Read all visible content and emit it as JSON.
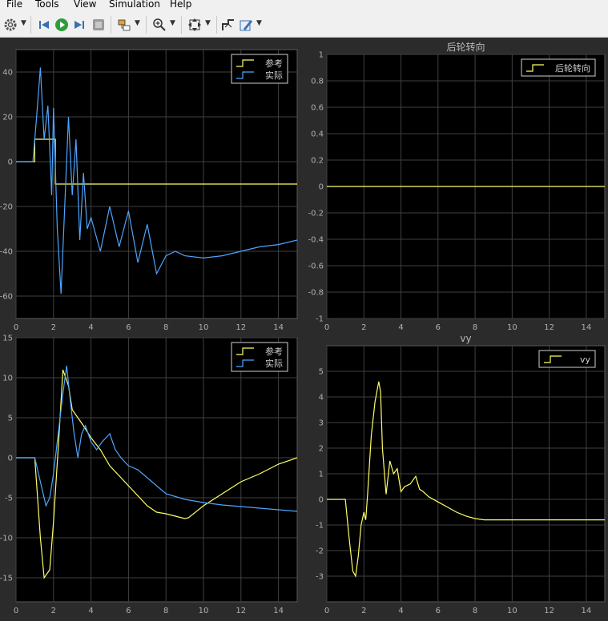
{
  "menubar": {
    "items": [
      "File",
      "Tools",
      "View",
      "Simulation",
      "Help"
    ]
  },
  "toolbar": {
    "icons": [
      "gear-icon",
      "step-back-icon",
      "run-icon",
      "step-forward-icon",
      "stop-icon",
      "highlight-block-icon",
      "zoom-icon",
      "fit-to-view-icon",
      "cursor-measure-icon",
      "edit-style-icon"
    ]
  },
  "colors": {
    "reference": "#ffff66",
    "actual": "#4da6ff",
    "axes_bg": "#000000",
    "figure_bg": "#2b2b2b",
    "grid": "#404040",
    "tick_text": "#b0b0b0"
  },
  "chart_data": [
    {
      "type": "line",
      "title": "",
      "xlim": [
        0,
        15
      ],
      "ylim": [
        -70,
        50
      ],
      "xticks": [
        0,
        2,
        4,
        6,
        8,
        10,
        12,
        14
      ],
      "yticks": [
        40,
        20,
        0,
        -20,
        -40,
        -60
      ],
      "grid": true,
      "legend_position": "top-right",
      "series": [
        {
          "name": "参考",
          "color": "#ffff66",
          "x": [
            0,
            1.0,
            1.0,
            2.1,
            2.1,
            15
          ],
          "y": [
            0,
            0,
            10,
            10,
            -10,
            -10
          ]
        },
        {
          "name": "实际",
          "color": "#4da6ff",
          "x": [
            0,
            0.9,
            1.1,
            1.3,
            1.5,
            1.7,
            1.9,
            2.0,
            2.2,
            2.4,
            2.6,
            2.8,
            3.0,
            3.2,
            3.4,
            3.6,
            3.8,
            4.0,
            4.5,
            5.0,
            5.5,
            6.0,
            6.5,
            7.0,
            7.5,
            8.0,
            8.5,
            9.0,
            10.0,
            11.0,
            12.0,
            13.0,
            14.0,
            15.0
          ],
          "y": [
            0,
            0,
            20,
            42,
            10,
            25,
            -15,
            24,
            -30,
            -59,
            -20,
            20,
            -15,
            10,
            -35,
            -5,
            -30,
            -25,
            -40,
            -20,
            -38,
            -22,
            -45,
            -28,
            -50,
            -42,
            -40,
            -42,
            -43,
            -42,
            -40,
            -38,
            -37,
            -35
          ]
        }
      ]
    },
    {
      "type": "line",
      "title": "后轮转向",
      "xlim": [
        0,
        15
      ],
      "ylim": [
        -1,
        1
      ],
      "xticks": [
        0,
        2,
        4,
        6,
        8,
        10,
        12,
        14
      ],
      "yticks": [
        1,
        0.8,
        0.6,
        0.4,
        0.2,
        0,
        -0.2,
        -0.4,
        -0.6,
        -0.8,
        -1
      ],
      "grid": true,
      "legend_position": "top-right",
      "series": [
        {
          "name": "后轮转向",
          "color": "#ffff66",
          "x": [
            0,
            15
          ],
          "y": [
            0,
            0
          ]
        }
      ]
    },
    {
      "type": "line",
      "title": "",
      "xlim": [
        0,
        15
      ],
      "ylim": [
        -18,
        15
      ],
      "xticks": [
        0,
        2,
        4,
        6,
        8,
        10,
        12,
        14
      ],
      "yticks": [
        15,
        10,
        5,
        0,
        -5,
        -10,
        -15
      ],
      "grid": true,
      "legend_position": "top-right",
      "series": [
        {
          "name": "参考",
          "color": "#ffff66",
          "x": [
            0,
            1.0,
            1.3,
            1.5,
            1.8,
            2.0,
            2.3,
            2.5,
            2.8,
            3.0,
            3.3,
            3.6,
            4.0,
            4.5,
            5.0,
            6.0,
            7.0,
            7.5,
            8.0,
            8.5,
            9.0,
            9.2,
            10.0,
            11.0,
            12.0,
            13.0,
            14.0,
            15.0
          ],
          "y": [
            0,
            0,
            -10,
            -15,
            -14,
            -8,
            3,
            11,
            9,
            6,
            5,
            4,
            2.5,
            1,
            -1,
            -3.5,
            -6,
            -6.8,
            -7,
            -7.3,
            -7.6,
            -7.5,
            -6,
            -4.5,
            -3,
            -2,
            -0.8,
            0
          ]
        },
        {
          "name": "实际",
          "color": "#4da6ff",
          "x": [
            0,
            1.0,
            1.3,
            1.6,
            1.8,
            2.0,
            2.2,
            2.5,
            2.7,
            2.9,
            3.1,
            3.3,
            3.5,
            3.7,
            4.0,
            4.3,
            4.6,
            5.0,
            5.3,
            5.6,
            6.0,
            6.5,
            7.0,
            7.5,
            8.0,
            9.0,
            10.0,
            11.0,
            12.0,
            13.0,
            14.0,
            15.0
          ],
          "y": [
            0,
            0,
            -3,
            -6,
            -5,
            -2,
            2,
            8,
            11.5,
            7,
            3,
            0,
            3,
            4,
            2,
            1,
            2,
            3,
            1,
            0,
            -1,
            -1.5,
            -2.5,
            -3.5,
            -4.5,
            -5.2,
            -5.6,
            -5.9,
            -6.1,
            -6.3,
            -6.5,
            -6.7
          ]
        }
      ]
    },
    {
      "type": "line",
      "title": "vy",
      "xlim": [
        0,
        15
      ],
      "ylim": [
        -4,
        6
      ],
      "xticks": [
        0,
        2,
        4,
        6,
        8,
        10,
        12,
        14
      ],
      "yticks": [
        5,
        4,
        3,
        2,
        1,
        0,
        -1,
        -2,
        -3
      ],
      "grid": true,
      "legend_position": "top-right",
      "series": [
        {
          "name": "vy",
          "color": "#ffff66",
          "x": [
            0,
            1.0,
            1.2,
            1.4,
            1.55,
            1.7,
            1.85,
            2.0,
            2.1,
            2.2,
            2.4,
            2.6,
            2.8,
            2.9,
            3.0,
            3.2,
            3.4,
            3.6,
            3.8,
            4.0,
            4.2,
            4.5,
            4.8,
            5.0,
            5.2,
            5.5,
            6.0,
            6.5,
            7.0,
            7.5,
            8.0,
            8.5,
            9.0,
            10.0,
            11.0,
            12.0,
            13.0,
            14.0,
            15.0
          ],
          "y": [
            0,
            0,
            -1.5,
            -2.8,
            -3.0,
            -2.2,
            -1.0,
            -0.5,
            -0.8,
            0.2,
            2.5,
            3.8,
            4.6,
            4.2,
            2.0,
            0.2,
            1.5,
            1.0,
            1.2,
            0.3,
            0.5,
            0.6,
            0.9,
            0.4,
            0.3,
            0.1,
            -0.1,
            -0.3,
            -0.5,
            -0.65,
            -0.75,
            -0.8,
            -0.8,
            -0.8,
            -0.8,
            -0.8,
            -0.8,
            -0.8,
            -0.8
          ]
        }
      ]
    }
  ]
}
